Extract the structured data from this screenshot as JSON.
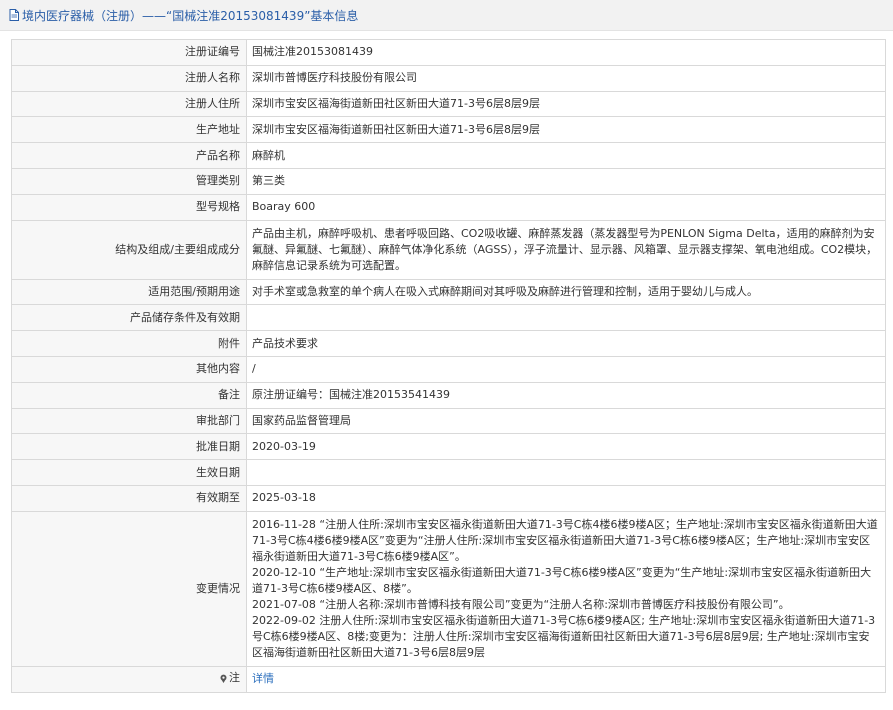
{
  "header": {
    "title": "境内医疗器械（注册）——“国械注准20153081439”基本信息"
  },
  "rows": [
    {
      "label": "注册证编号",
      "value": "国械注准20153081439"
    },
    {
      "label": "注册人名称",
      "value": "深圳市普博医疗科技股份有限公司"
    },
    {
      "label": "注册人住所",
      "value": "深圳市宝安区福海街道新田社区新田大道71-3号6层8层9层"
    },
    {
      "label": "生产地址",
      "value": "深圳市宝安区福海街道新田社区新田大道71-3号6层8层9层"
    },
    {
      "label": "产品名称",
      "value": "麻醉机"
    },
    {
      "label": "管理类别",
      "value": "第三类"
    },
    {
      "label": "型号规格",
      "value": "Boaray 600"
    },
    {
      "label": "结构及组成/主要组成成分",
      "value": "产品由主机，麻醉呼吸机、患者呼吸回路、CO2吸收罐、麻醉蒸发器（蒸发器型号为PENLON Sigma Delta，适用的麻醉剂为安氟醚、异氟醚、七氟醚）、麻醉气体净化系统（AGSS），浮子流量计、显示器、风箱罩、显示器支撑架、氧电池组成。CO2模块，麻醉信息记录系统为可选配置。"
    },
    {
      "label": "适用范围/预期用途",
      "value": "对手术室或急救室的单个病人在吸入式麻醉期间对其呼吸及麻醉进行管理和控制，适用于婴幼儿与成人。"
    },
    {
      "label": "产品储存条件及有效期",
      "value": ""
    },
    {
      "label": "附件",
      "value": "产品技术要求"
    },
    {
      "label": "其他内容",
      "value": "/"
    },
    {
      "label": "备注",
      "value": "原注册证编号：国械注准20153541439"
    },
    {
      "label": "审批部门",
      "value": "国家药品监督管理局"
    },
    {
      "label": "批准日期",
      "value": "2020-03-19"
    },
    {
      "label": "生效日期",
      "value": ""
    },
    {
      "label": "有效期至",
      "value": "2025-03-18"
    }
  ],
  "changes": {
    "label": "变更情况",
    "entries": [
      "2016-11-28 “注册人住所:深圳市宝安区福永街道新田大道71-3号C栋4楼6楼9楼A区；生产地址:深圳市宝安区福永街道新田大道71-3号C栋4楼6楼9楼A区”变更为“注册人住所:深圳市宝安区福永街道新田大道71-3号C栋6楼9楼A区；生产地址:深圳市宝安区福永街道新田大道71-3号C栋6楼9楼A区”。",
      "2020-12-10 “生产地址:深圳市宝安区福永街道新田大道71-3号C栋6楼9楼A区”变更为“生产地址:深圳市宝安区福永街道新田大道71-3号C栋6楼9楼A区、8楼”。",
      "2021-07-08 “注册人名称:深圳市普博科技有限公司”变更为“注册人名称:深圳市普博医疗科技股份有限公司”。",
      "2022-09-02 注册人住所:深圳市宝安区福永街道新田大道71-3号C栋6楼9楼A区; 生产地址:深圳市宝安区福永街道新田大道71-3号C栋6楼9楼A区、8楼;变更为：注册人住所:深圳市宝安区福海街道新田社区新田大道71-3号6层8层9层; 生产地址:深圳市宝安区福海街道新田社区新田大道71-3号6层8层9层"
    ]
  },
  "note": {
    "label": "注",
    "link": "详情"
  },
  "colors": {
    "header_bg": "#f2f2f2",
    "header_text": "#2a5ea8",
    "label_bg": "#f7f7f7",
    "border": "#d9d9d9",
    "link": "#2a6ebd"
  }
}
